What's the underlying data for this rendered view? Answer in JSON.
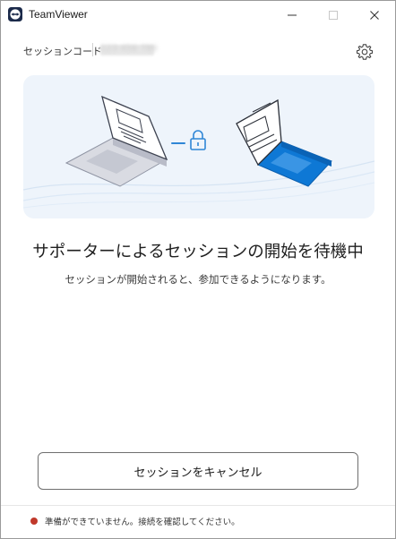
{
  "window": {
    "title": "TeamViewer",
    "controls": {
      "minimize": "minimize-icon",
      "maximize": "maximize-icon",
      "close": "close-icon"
    }
  },
  "session": {
    "label": "セッションコード",
    "code": "123 456 789"
  },
  "main": {
    "headline": "サポーターによるセッションの開始を待機中",
    "subline": "セッションが開始されると、参加できるようになります。",
    "cancel_label": "セッションをキャンセル"
  },
  "status": {
    "text": "準備ができていません。接続を確認してください。",
    "color": "#c0392b"
  },
  "colors": {
    "accent": "#0e78d5",
    "illustration_bg": "#eef4fb"
  }
}
